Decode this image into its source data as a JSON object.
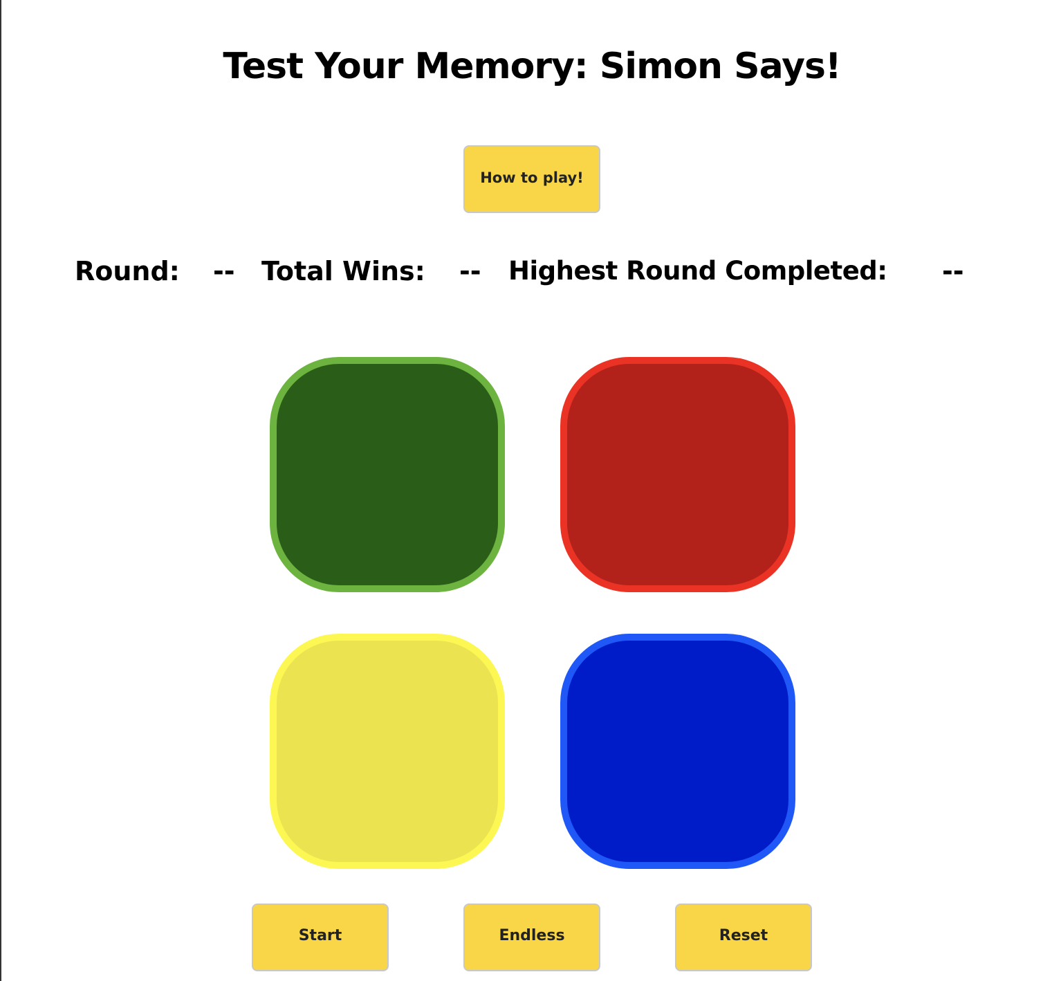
{
  "title": "Test Your Memory: Simon Says!",
  "buttons": {
    "how_to_play": "How to play!",
    "start": "Start",
    "endless": "Endless",
    "reset": "Reset"
  },
  "stats": {
    "round_label": "Round:",
    "round_value": "--",
    "wins_label": "Total Wins:",
    "wins_value": "--",
    "highest_label": "Highest Round Completed:",
    "highest_value": "--"
  },
  "pads": [
    {
      "name": "green",
      "fill": "#2a5e18",
      "border": "#6cb33f"
    },
    {
      "name": "red",
      "fill": "#b2221b",
      "border": "#ea3324"
    },
    {
      "name": "yellow",
      "fill": "#ebe350",
      "border": "#fdf753"
    },
    {
      "name": "blue",
      "fill": "#001bc8",
      "border": "#1f58f6"
    }
  ],
  "colors": {
    "button_bg": "#f8d648",
    "button_border": "#c8c8c8",
    "background": "#ffffff"
  }
}
